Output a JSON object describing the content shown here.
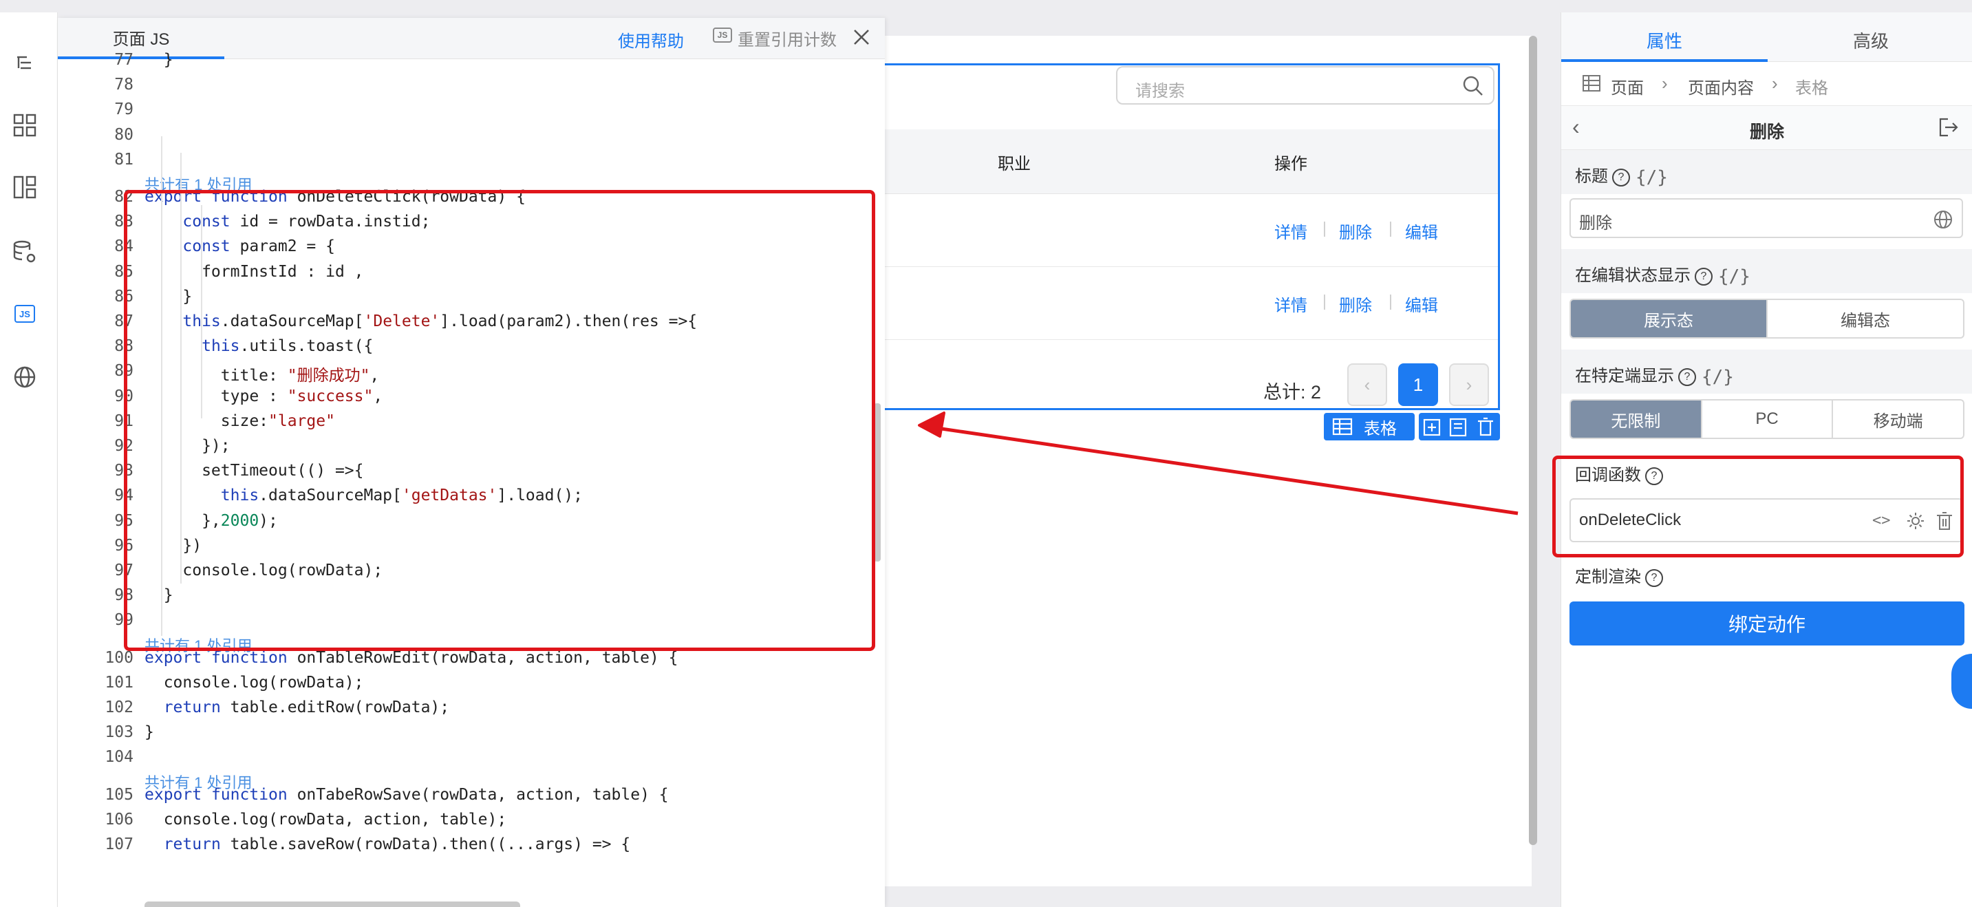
{
  "editor": {
    "tab_label": "页面 JS",
    "help_label": "使用帮助",
    "js_badge": "JS",
    "reset_label": "重置引用计数"
  },
  "code": {
    "lines": [
      {
        "n": "77",
        "text": "  }"
      },
      {
        "n": "78",
        "text": ""
      },
      {
        "n": "79",
        "text": ""
      },
      {
        "n": "80",
        "text": ""
      },
      {
        "n": "81",
        "text": ""
      },
      {
        "n": "82",
        "text": "export function onDeleteClick(rowData) {"
      },
      {
        "n": "83",
        "text": "    const id = rowData.instid;"
      },
      {
        "n": "84",
        "text": "    const param2 = {"
      },
      {
        "n": "85",
        "text": "      formInstId : id ,"
      },
      {
        "n": "86",
        "text": "    }"
      },
      {
        "n": "87",
        "text": "    this.dataSourceMap['Delete'].load(param2).then(res =>{"
      },
      {
        "n": "88",
        "text": "      this.utils.toast({"
      },
      {
        "n": "89",
        "text": "        title: \"删除成功\","
      },
      {
        "n": "90",
        "text": "        type : \"success\","
      },
      {
        "n": "91",
        "text": "        size:\"large\""
      },
      {
        "n": "92",
        "text": "      });"
      },
      {
        "n": "93",
        "text": "      setTimeout(() =>{"
      },
      {
        "n": "94",
        "text": "        this.dataSourceMap['getDatas'].load();"
      },
      {
        "n": "95",
        "text": "      },2000);"
      },
      {
        "n": "96",
        "text": "    })"
      },
      {
        "n": "97",
        "text": "    console.log(rowData);"
      },
      {
        "n": "98",
        "text": "  }"
      },
      {
        "n": "99",
        "text": ""
      },
      {
        "n": "100",
        "text": "export function onTableRowEdit(rowData, action, table) {"
      },
      {
        "n": "101",
        "text": "  console.log(rowData);"
      },
      {
        "n": "102",
        "text": "  return table.editRow(rowData);"
      },
      {
        "n": "103",
        "text": "}"
      },
      {
        "n": "104",
        "text": ""
      },
      {
        "n": "105",
        "text": "export function onTabeRowSave(rowData, action, table) {"
      },
      {
        "n": "106",
        "text": "  console.log(rowData, action, table);"
      },
      {
        "n": "107",
        "text": "  return table.saveRow(rowData).then((...args) => {"
      }
    ],
    "ref_note": "共计有 1 处引用"
  },
  "table": {
    "search_placeholder": "请搜索",
    "columns": [
      "职业",
      "操作"
    ],
    "row_actions": [
      "详情",
      "删除",
      "编辑"
    ],
    "total_label": "总计: 2",
    "current_page": "1",
    "component_label": "表格"
  },
  "panel": {
    "tabs": [
      "属性",
      "高级"
    ],
    "breadcrumb": [
      "页面",
      "页面内容",
      "表格"
    ],
    "title": "删除",
    "title_label": "标题",
    "title_value": "删除",
    "edit_state_label": "在编辑状态显示",
    "edit_state_options": [
      "展示态",
      "编辑态"
    ],
    "device_label": "在特定端显示",
    "device_options": [
      "无限制",
      "PC",
      "移动端"
    ],
    "callback_label": "回调函数",
    "callback_value": "onDeleteClick",
    "custom_render_label": "定制渲染",
    "bind_button": "绑定动作",
    "expr_symbol": "{/}",
    "help_symbol": "?"
  },
  "colors": {
    "accent": "#1d7bf2",
    "annotation": "#e0151b",
    "keyword": "#1e3fb8",
    "string": "#a31515",
    "number": "#098658"
  }
}
